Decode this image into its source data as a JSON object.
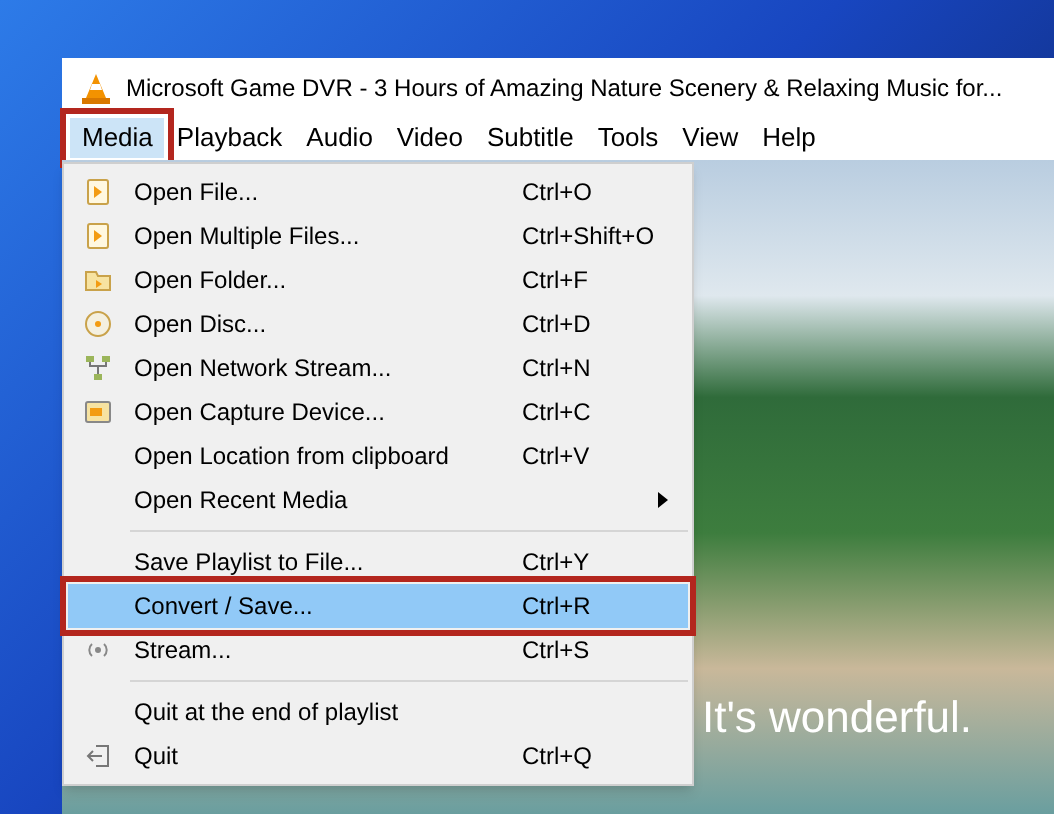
{
  "window": {
    "title": "Microsoft Game DVR - 3 Hours of Amazing Nature Scenery & Relaxing Music for..."
  },
  "menu_bar": [
    {
      "label": "Media",
      "selected": true
    },
    {
      "label": "Playback",
      "selected": false
    },
    {
      "label": "Audio",
      "selected": false
    },
    {
      "label": "Video",
      "selected": false
    },
    {
      "label": "Subtitle",
      "selected": false
    },
    {
      "label": "Tools",
      "selected": false
    },
    {
      "label": "View",
      "selected": false
    },
    {
      "label": "Help",
      "selected": false
    }
  ],
  "menu": [
    {
      "kind": "file",
      "label": "Open File...",
      "shortcut": "Ctrl+O",
      "selected": false
    },
    {
      "kind": "file",
      "label": "Open Multiple Files...",
      "shortcut": "Ctrl+Shift+O",
      "selected": false
    },
    {
      "kind": "folder",
      "label": "Open Folder...",
      "shortcut": "Ctrl+F",
      "selected": false
    },
    {
      "kind": "disc",
      "label": "Open Disc...",
      "shortcut": "Ctrl+D",
      "selected": false
    },
    {
      "kind": "network",
      "label": "Open Network Stream...",
      "shortcut": "Ctrl+N",
      "selected": false
    },
    {
      "kind": "capture",
      "label": "Open Capture Device...",
      "shortcut": "Ctrl+C",
      "selected": false
    },
    {
      "kind": "plain",
      "label": "Open Location from clipboard",
      "shortcut": "Ctrl+V",
      "selected": false
    },
    {
      "kind": "submenu",
      "label": "Open Recent Media",
      "selected": false
    },
    {
      "kind": "separator"
    },
    {
      "kind": "plain",
      "label": "Save Playlist to File...",
      "shortcut": "Ctrl+Y",
      "selected": false
    },
    {
      "kind": "plain",
      "label": "Convert / Save...",
      "shortcut": "Ctrl+R",
      "selected": true
    },
    {
      "kind": "stream",
      "label": "Stream...",
      "shortcut": "Ctrl+S",
      "selected": false
    },
    {
      "kind": "separator"
    },
    {
      "kind": "plain",
      "label": "Quit at the end of playlist",
      "selected": false
    },
    {
      "kind": "quit",
      "label": "Quit",
      "shortcut": "Ctrl+Q",
      "selected": false
    }
  ],
  "video": {
    "subtitle": "It's wonderful."
  }
}
